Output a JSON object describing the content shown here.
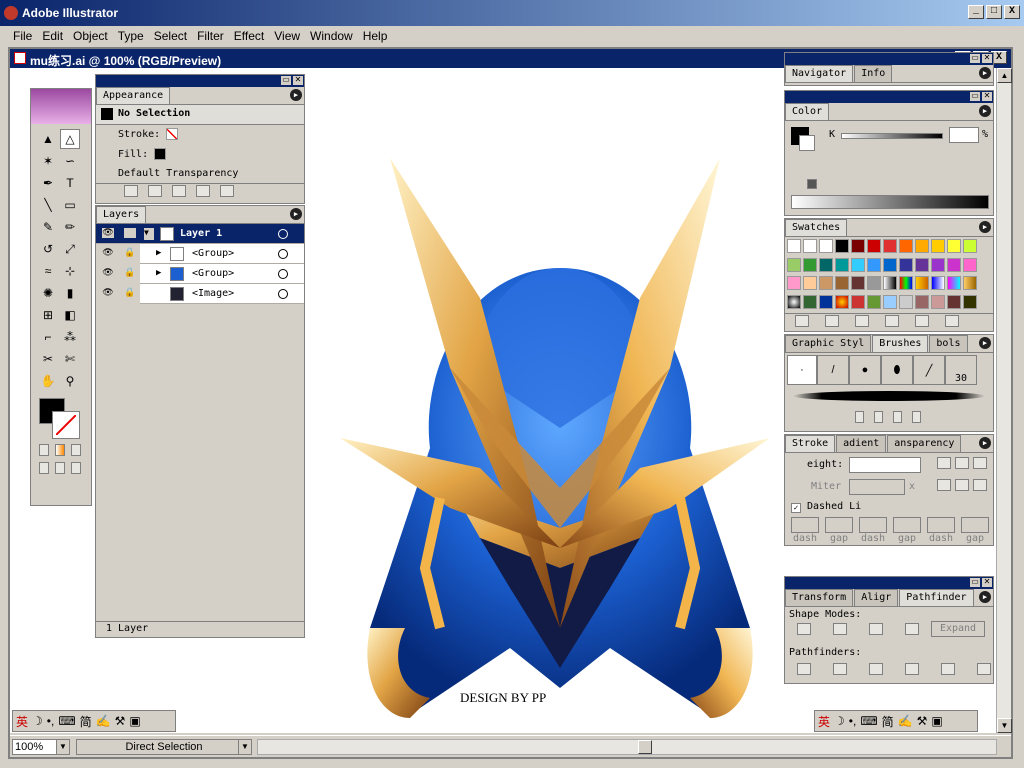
{
  "app": {
    "title": "Adobe Illustrator",
    "window_buttons": [
      "_",
      "□",
      "X"
    ]
  },
  "menu": [
    "File",
    "Edit",
    "Object",
    "Type",
    "Select",
    "Filter",
    "Effect",
    "View",
    "Window",
    "Help"
  ],
  "document": {
    "title": "mu练习.ai @ 100% (RGB/Preview)",
    "credit": "DESIGN BY PP"
  },
  "status": {
    "zoom": "100%",
    "tool": "Direct Selection"
  },
  "appearance": {
    "tab": "Appearance",
    "header": "No Selection",
    "stroke_label": "Stroke:",
    "fill_label": "Fill:",
    "transparency": "Default Transparency"
  },
  "layers": {
    "tab": "Layers",
    "items": [
      {
        "label": "Layer 1"
      },
      {
        "label": "<Group>"
      },
      {
        "label": "<Group>"
      },
      {
        "label": "<Image>"
      }
    ],
    "footer": "1 Layer"
  },
  "navigator": {
    "tabs": [
      "Navigator",
      "Info"
    ]
  },
  "color": {
    "tab": "Color",
    "channel": "K",
    "unit": "%"
  },
  "swatches": {
    "tab": "Swatches"
  },
  "brushes": {
    "tabs": [
      "Graphic Styl",
      "Brushes",
      "bols"
    ],
    "size_label": "30"
  },
  "stroke": {
    "tabs": [
      "Stroke",
      "adient",
      "ansparency"
    ],
    "weight_label": "eight:",
    "miter_label": "Miter",
    "miter_unit": "x",
    "dashed_label": "Dashed Li",
    "dash_labels": [
      "dash",
      "gap",
      "dash",
      "gap",
      "dash",
      "gap"
    ]
  },
  "pathfinder": {
    "tabs": [
      "Transform",
      "Aligr",
      "Pathfinder"
    ],
    "shape_modes_label": "Shape Modes:",
    "expand_label": "Expand",
    "pathfinders_label": "Pathfinders:"
  },
  "ime": {
    "lang": "英",
    "mode": "简"
  },
  "colors": {
    "accent": "#0a246a",
    "face": "#d4d0c8"
  }
}
